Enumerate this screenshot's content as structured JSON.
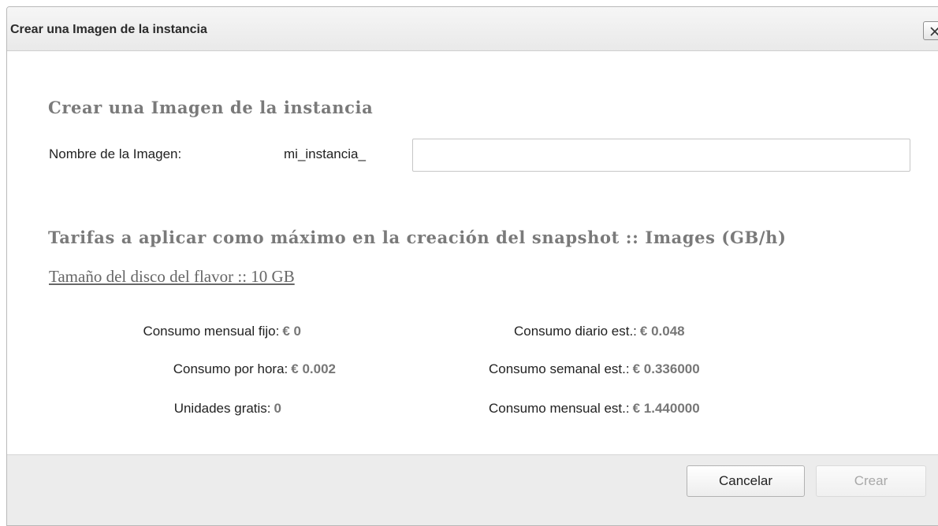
{
  "dialog": {
    "title": "Crear una Imagen de la instancia",
    "close_symbol": "close-icon"
  },
  "form": {
    "heading": "Crear una Imagen de la instancia",
    "name_label": "Nombre de la Imagen:",
    "name_prefix": "mi_instancia_",
    "name_value": "",
    "name_placeholder": ""
  },
  "pricing": {
    "heading": "Tarifas a aplicar como máximo en la creación del snapshot :: Images (GB/h)",
    "flavor_link": "Tamaño del disco del flavor :: 10 GB",
    "left": [
      {
        "label": "Consumo mensual fijo:",
        "value": "€ 0"
      },
      {
        "label": "Consumo por hora:",
        "value": "€ 0.002"
      },
      {
        "label": "Unidades gratis:",
        "value": "0"
      }
    ],
    "right": [
      {
        "label": "Consumo diario est.:",
        "value": "€ 0.048"
      },
      {
        "label": "Consumo semanal est.:",
        "value": "€ 0.336000"
      },
      {
        "label": "Consumo mensual est.:",
        "value": "€ 1.440000"
      }
    ]
  },
  "footer": {
    "cancel_label": "Cancelar",
    "create_label": "Crear"
  },
  "colors": {
    "heading": "#7a7a7a",
    "value": "#777777",
    "footer_bg": "#ececec"
  }
}
